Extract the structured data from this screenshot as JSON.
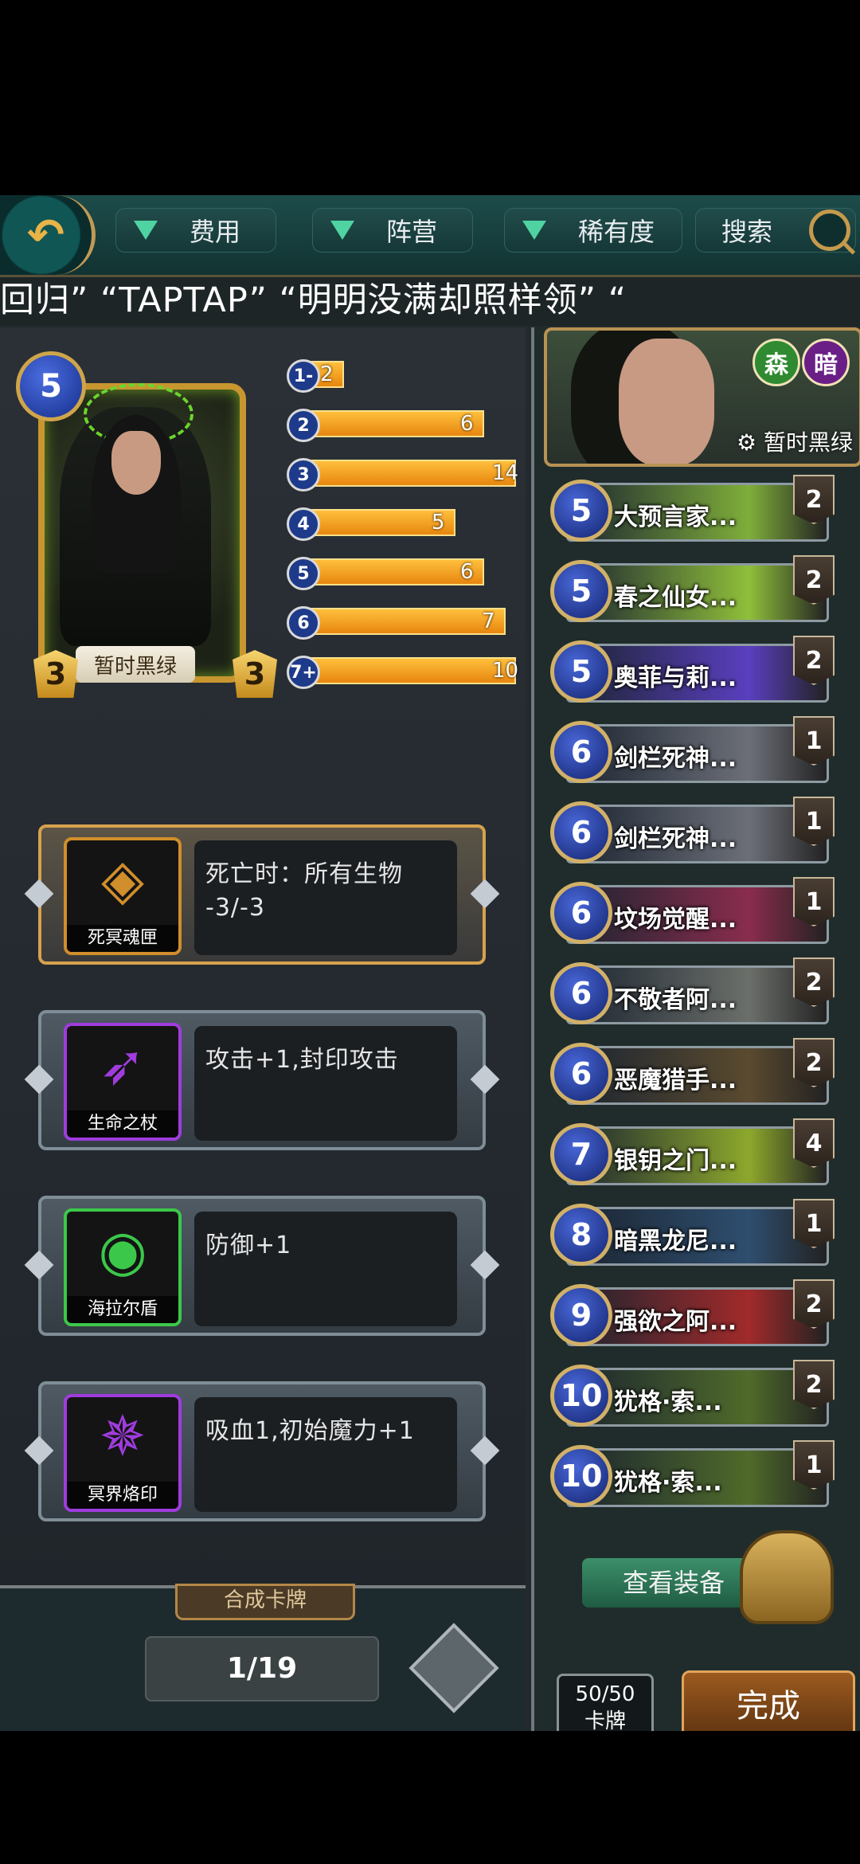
{
  "topbar": {
    "filters": {
      "cost": "费用",
      "faction": "阵营",
      "rarity": "稀有度",
      "search": "搜索"
    }
  },
  "marquee": "回归” “TAPTAP” “明明没满却照样领” “",
  "card": {
    "cost": "5",
    "name": "暂时黑绿",
    "attack": "3",
    "health": "3"
  },
  "curve": [
    {
      "label": "1-",
      "value": "2",
      "fraction": 0.2
    },
    {
      "label": "2",
      "value": "6",
      "fraction": 0.85
    },
    {
      "label": "3",
      "value": "14",
      "fraction": 1.0
    },
    {
      "label": "4",
      "value": "5",
      "fraction": 0.72
    },
    {
      "label": "5",
      "value": "6",
      "fraction": 0.85
    },
    {
      "label": "6",
      "value": "7",
      "fraction": 0.95
    },
    {
      "label": "7+",
      "value": "10",
      "fraction": 1.0
    }
  ],
  "equipment": [
    {
      "name": "死冥魂匣",
      "effect": "死亡时：所有生物 -3/-3",
      "icon": "blue-cube-icon",
      "color": "#d08e2c"
    },
    {
      "name": "生命之杖",
      "effect": "攻击+1,封印攻击",
      "icon": "horn-staff-icon",
      "color": "#a03cde"
    },
    {
      "name": "海拉尔盾",
      "effect": "防御+1",
      "icon": "round-shield-icon",
      "color": "#3bc84a"
    },
    {
      "name": "冥界烙印",
      "effect": "吸血1,初始魔力+1",
      "icon": "rune-brand-icon",
      "color": "#a03cde"
    }
  ],
  "synth": {
    "tab_label": "合成卡牌",
    "page": "1/19"
  },
  "hero": {
    "factions": [
      "森",
      "暗"
    ],
    "name": "暂时黑绿"
  },
  "deck": [
    {
      "cost": "5",
      "name": "大预言家...",
      "count": "2",
      "color": "#7fae3a"
    },
    {
      "cost": "5",
      "name": "春之仙女...",
      "count": "2",
      "color": "#8fbf3a"
    },
    {
      "cost": "5",
      "name": "奥菲与莉...",
      "count": "2",
      "color": "#5a3fbf"
    },
    {
      "cost": "6",
      "name": "剑栏死神...",
      "count": "1",
      "color": "#6c6f78"
    },
    {
      "cost": "6",
      "name": "剑栏死神...",
      "count": "1",
      "color": "#6c6f78"
    },
    {
      "cost": "6",
      "name": "坟场觉醒...",
      "count": "1",
      "color": "#8a2c4d"
    },
    {
      "cost": "6",
      "name": "不敬者阿...",
      "count": "2",
      "color": "#6b6f6a"
    },
    {
      "cost": "6",
      "name": "恶魔猎手...",
      "count": "2",
      "color": "#5a4a2f"
    },
    {
      "cost": "7",
      "name": "银钥之门...",
      "count": "4",
      "color": "#8da82c"
    },
    {
      "cost": "8",
      "name": "暗黑龙尼...",
      "count": "1",
      "color": "#2e4e6e"
    },
    {
      "cost": "9",
      "name": "强欲之阿...",
      "count": "2",
      "color": "#a12a2a"
    },
    {
      "cost": "10",
      "name": "犹格·索...",
      "count": "2",
      "color": "#4f6a2a"
    },
    {
      "cost": "10",
      "name": "犹格·索...",
      "count": "1",
      "color": "#4f6a2a"
    }
  ],
  "footer": {
    "view_equipment": "查看装备",
    "card_count_top": "50/50",
    "card_count_bottom": "卡牌",
    "done": "完成"
  }
}
